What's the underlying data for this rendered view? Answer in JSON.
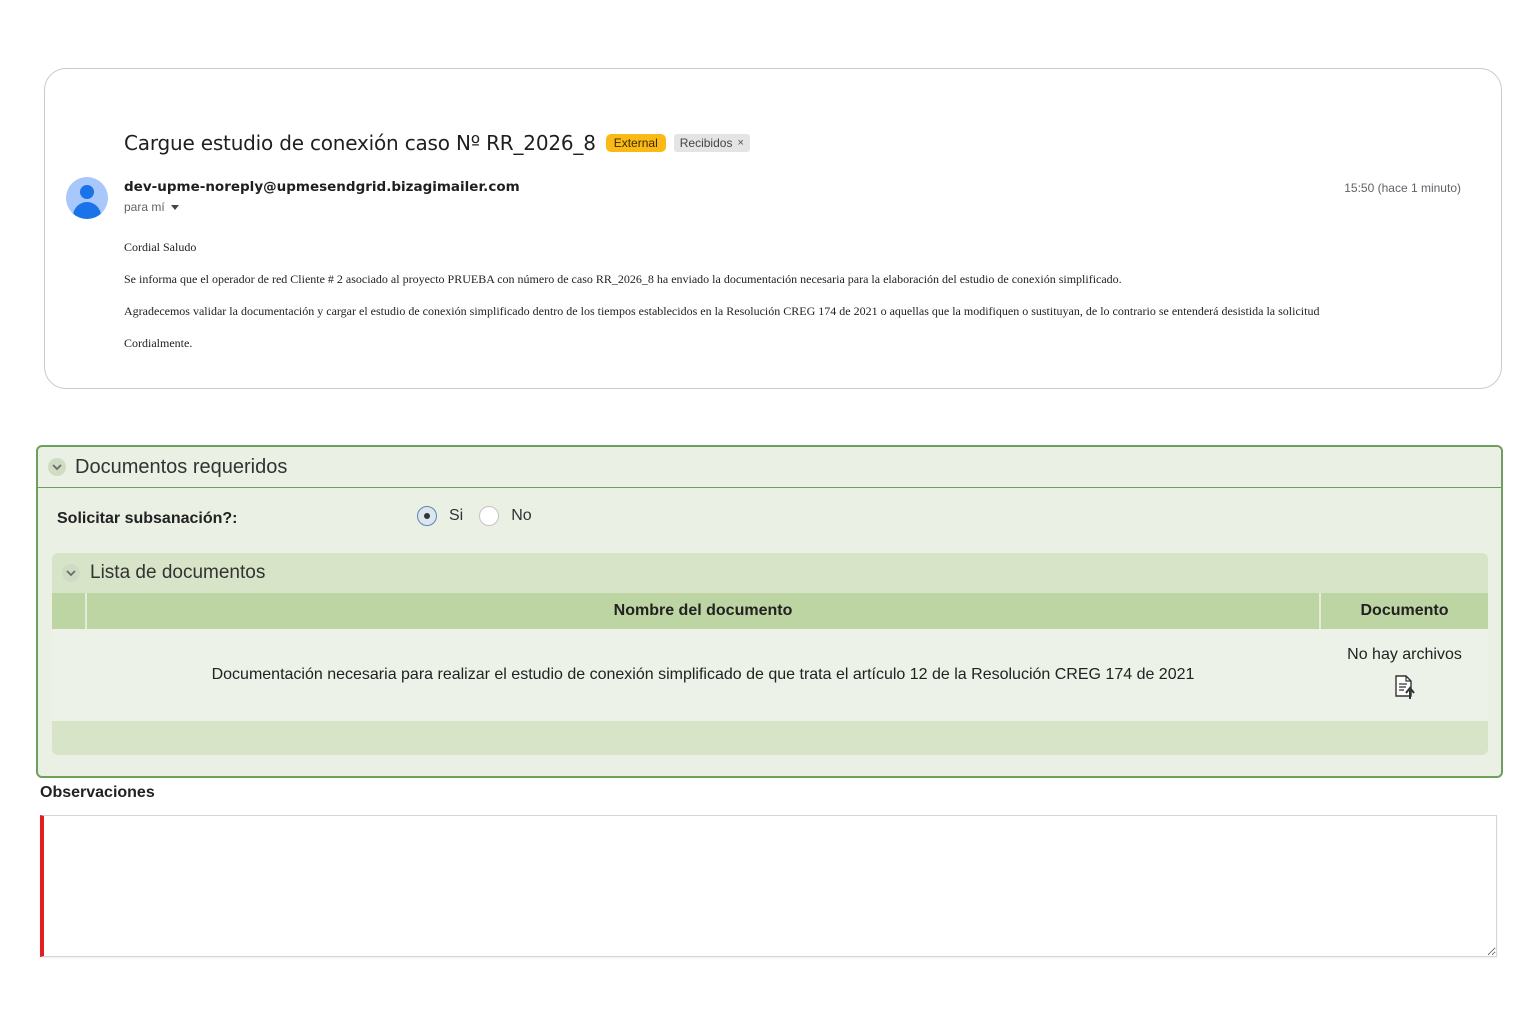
{
  "email": {
    "subject": "Cargue estudio de conexión caso Nº RR_2026_8",
    "labels": {
      "external": "External",
      "inbox": "Recibidos",
      "inbox_close": "×"
    },
    "sender": "dev-upme-noreply@upmesendgrid.bizagimailer.com",
    "to": "para mí",
    "timestamp": "15:50 (hace 1 minuto)",
    "body": [
      "Cordial Saludo",
      "Se informa que el operador de red Cliente # 2 asociado al proyecto PRUEBA con número de caso RR_2026_8 ha enviado la documentación necesaria para la elaboración del estudio de conexión simplificado.",
      "Agradecemos validar la documentación y cargar el estudio de conexión simplificado dentro de los tiempos establecidos en la Resolución CREG 174 de 2021 o aquellas que la modifiquen o sustituyan, de lo contrario se entenderá desistida la solicitud",
      "Cordialmente."
    ]
  },
  "docs": {
    "title": "Documentos requeridos",
    "subsanacion_label": "Solicitar subsanación?:",
    "options": {
      "yes": "Si",
      "no": "No"
    },
    "selected": "Si",
    "list_title": "Lista de documentos",
    "columns": {
      "name": "Nombre del documento",
      "document": "Documento"
    },
    "rows": [
      {
        "name": "Documentación necesaria para realizar el estudio de conexión simplificado de que trata el artículo 12 de la Resolución CREG 174 de 2021",
        "status": "No hay archivos"
      }
    ]
  },
  "observations": {
    "label": "Observaciones",
    "value": ""
  },
  "colors": {
    "panel_border": "#6f9f5c",
    "header_green": "#bdd5a3",
    "badge_external": "#f9b916",
    "required_marker": "#e02020"
  },
  "icons": [
    "chevron-down-icon",
    "upload-document-icon",
    "avatar-icon",
    "caret-down-icon"
  ]
}
